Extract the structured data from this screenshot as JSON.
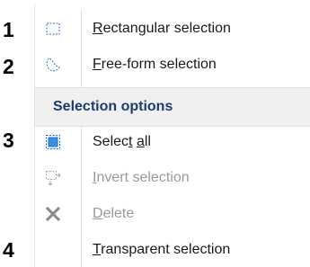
{
  "annotations": [
    "1",
    "2",
    "3",
    "4"
  ],
  "menu": {
    "items": [
      {
        "prefix": "",
        "mnemonic": "R",
        "suffix": "ectangular selection",
        "icon": "rectangle-select-icon",
        "enabled": true
      },
      {
        "prefix": "",
        "mnemonic": "F",
        "suffix": "ree-form selection",
        "icon": "freeform-select-icon",
        "enabled": true
      }
    ],
    "section_header": "Selection options",
    "option_items": [
      {
        "prefix": "Selec",
        "mnemonic": "t",
        "middle": " ",
        "mnemonic2": "a",
        "suffix": "ll",
        "icon": "select-all-icon",
        "enabled": true
      },
      {
        "prefix": "",
        "mnemonic": "I",
        "suffix": "nvert selection",
        "icon": "invert-selection-icon",
        "enabled": false
      },
      {
        "prefix": "",
        "mnemonic": "D",
        "suffix": "elete",
        "icon": "delete-x-icon",
        "enabled": false
      },
      {
        "prefix": "",
        "mnemonic": "T",
        "suffix": "ransparent selection",
        "icon": "",
        "enabled": true
      }
    ]
  },
  "colors": {
    "accent": "#1e70cf",
    "header_text": "#1e3b6e",
    "disabled_text": "#9a9a9a"
  }
}
